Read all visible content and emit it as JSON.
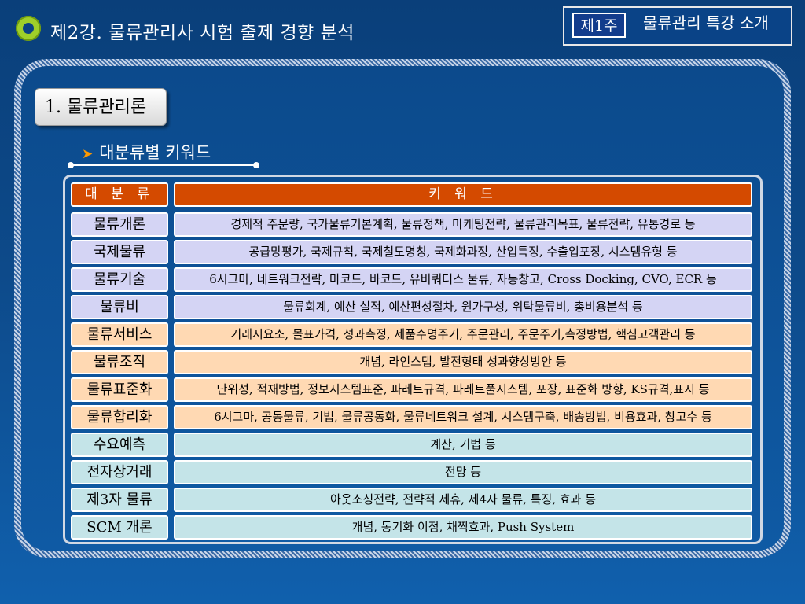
{
  "header": {
    "title": "제2강.  물류관리사 시험 출제 경향 분석",
    "week_badge": "제1주",
    "week_title": "물류관리 특강 소개"
  },
  "section": {
    "tab_label": "1. 물류관리론",
    "sub_heading": "대분류별 키워드"
  },
  "table": {
    "header": {
      "category": "대 분 류",
      "keywords": "키 워 드"
    },
    "rows": [
      {
        "category": "물류개론",
        "keywords": "경제적 주문량, 국가물류기본계획, 물류정책, 마케팅전략, 물류관리목표, 물류전략, 유통경로 등",
        "tone": "lavender"
      },
      {
        "category": "국제물류",
        "keywords": "공급망평가, 국제규칙, 국제철도명칭, 국제화과정, 산업특징, 수출입포장, 시스템유형 등",
        "tone": "lavender"
      },
      {
        "category": "물류기술",
        "keywords": "6시그마, 네트워크전략, 마코드, 바코드, 유비쿼터스 물류, 자동창고, Cross Docking, CVO, ECR 등",
        "tone": "lavender"
      },
      {
        "category": "물류비",
        "keywords": "물류회계, 예산 실적, 예산편성절차, 원가구성, 위탁물류비, 총비용분석 등",
        "tone": "lavender"
      },
      {
        "category": "물류서비스",
        "keywords": "거래시요소, 몰표가격, 성과측정, 제품수명주기, 주문관리, 주문주기,측정방법, 핵심고객관리 등",
        "tone": "peach"
      },
      {
        "category": "물류조직",
        "keywords": "개념, 라인스탭, 발전형태 성과향상방안 등",
        "tone": "peach"
      },
      {
        "category": "물류표준화",
        "keywords": "단위성, 적재방법, 정보시스템표준, 파레트규격, 파레트풀시스템, 포장, 표준화 방향, KS규격,표시 등",
        "tone": "peach"
      },
      {
        "category": "물류합리화",
        "keywords": "6시그마, 공동물류, 기법, 물류공동화, 물류네트워크 설계, 시스템구축, 배송방법, 비용효과, 창고수 등",
        "tone": "peach"
      },
      {
        "category": "수요예측",
        "keywords": "계산, 기법 등",
        "tone": "aqua"
      },
      {
        "category": "전자상거래",
        "keywords": "전망 등",
        "tone": "aqua"
      },
      {
        "category": "제3자 물류",
        "keywords": "아웃소싱전략, 전략적 제휴, 제4자 물류, 특징, 효과 등",
        "tone": "aqua"
      },
      {
        "category": "SCM 개론",
        "keywords": "개념, 동기화 이점, 채찍효과, Push System",
        "tone": "aqua"
      }
    ]
  }
}
